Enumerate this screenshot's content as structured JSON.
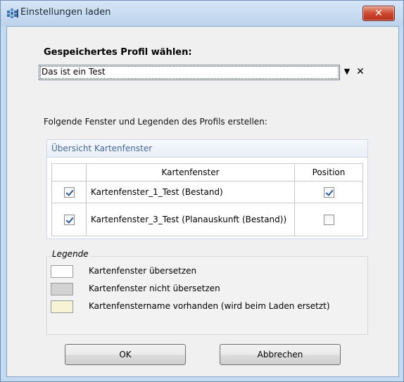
{
  "window": {
    "title": "Einstellungen laden",
    "close_label": "✕"
  },
  "profile": {
    "heading": "Gespeichertes Profil wählen:",
    "selected": "Das ist ein Test",
    "dropdown_glyph": "▼",
    "clear_glyph": "✕"
  },
  "instructions": "Folgende Fenster und Legenden des Profils erstellen:",
  "overview": {
    "header": "Übersicht Kartenfenster",
    "columns": [
      "",
      "Kartenfenster",
      "Position"
    ],
    "rows": [
      {
        "selected": true,
        "name": "Kartenfenster_1_Test (Bestand)",
        "position": true
      },
      {
        "selected": true,
        "name": "Kartenfenster_3_Test (Planauskunft (Bestand))",
        "position": false
      }
    ]
  },
  "legend": {
    "title": "Legende",
    "items": [
      {
        "color": "#ffffff",
        "label": "Kartenfenster übersetzen"
      },
      {
        "color": "#d3d3d3",
        "label": "Kartenfenster nicht übersetzen"
      },
      {
        "color": "#f6f4d5",
        "label": "Kartenfenstername vorhanden (wird beim Laden ersetzt)"
      }
    ]
  },
  "buttons": {
    "ok": "OK",
    "cancel": "Abbrechen"
  }
}
